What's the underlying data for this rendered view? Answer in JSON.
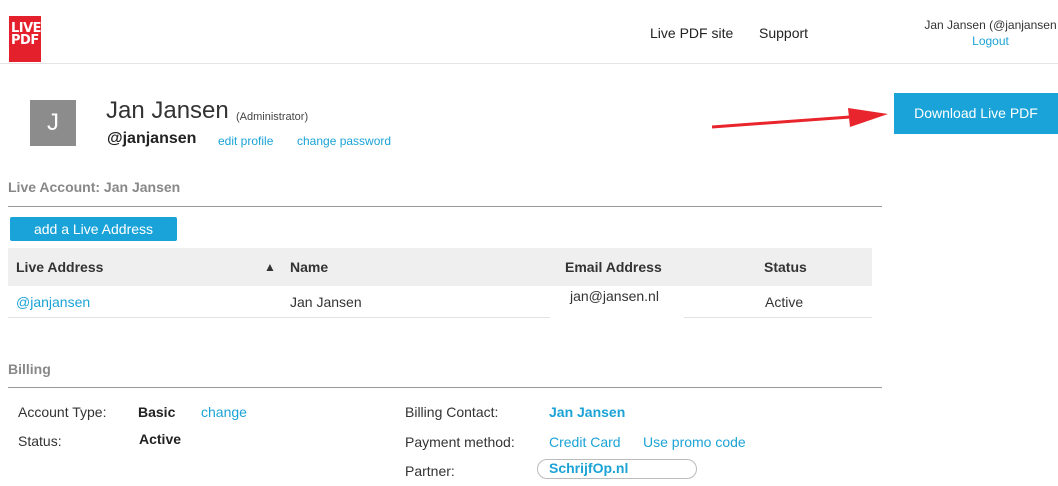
{
  "brand": {
    "logo_line1": "LIVE",
    "logo_line2": "PDF",
    "red": "#e3202c",
    "accent": "#1aa3d9"
  },
  "nav": {
    "live_pdf_site": "Live PDF site",
    "support": "Support"
  },
  "user": {
    "display": "Jan Jansen (@janjansen",
    "logout": "Logout"
  },
  "profile": {
    "avatar_letter": "J",
    "name": "Jan Jansen",
    "role": "(Administrator)",
    "handle": "@janjansen",
    "edit_profile": "edit profile",
    "change_password": "change password"
  },
  "download_button": "Download Live PDF",
  "account": {
    "title": "Live Account: Jan Jansen",
    "add_button": "add a Live Address",
    "columns": {
      "live_address": "Live Address",
      "sort_icon": "▲",
      "name": "Name",
      "email": "Email Address",
      "status": "Status"
    },
    "rows": [
      {
        "live_address": "@janjansen",
        "name": "Jan Jansen",
        "email": "jan@jansen.nl",
        "status": "Active"
      }
    ]
  },
  "billing": {
    "title": "Billing",
    "account_type_label": "Account Type:",
    "account_type_value": "Basic",
    "change": "change",
    "status_label": "Status:",
    "status_value": "Active",
    "billing_contact_label": "Billing Contact:",
    "billing_contact_value": "Jan Jansen",
    "payment_method_label": "Payment method:",
    "payment_method_value": "Credit Card",
    "promo": "Use promo code",
    "partner_label": "Partner:",
    "partner_value": "SchrijfOp.nl"
  }
}
